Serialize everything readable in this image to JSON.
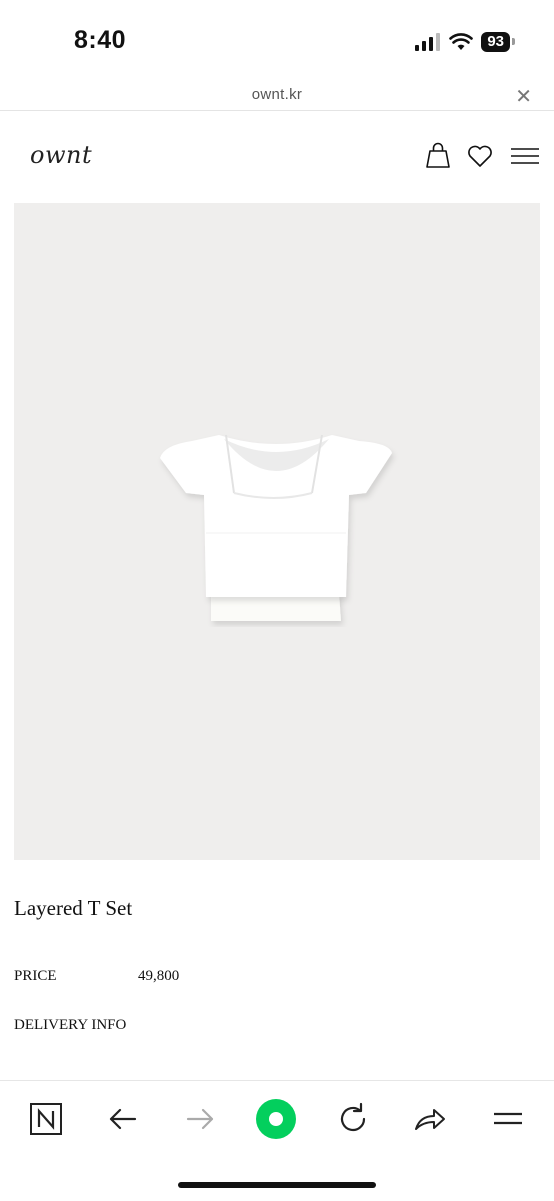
{
  "status_bar": {
    "time": "8:40",
    "battery": "93",
    "icons": [
      "signal-icon",
      "wifi-icon",
      "battery-icon"
    ]
  },
  "browser": {
    "url": "ownt.kr",
    "close_icon": "close-icon"
  },
  "header": {
    "logo": "ownt",
    "icons": [
      "shopping-bag-icon",
      "heart-icon",
      "menu-icon"
    ]
  },
  "product": {
    "image": "white-layered-t-set-photo",
    "name": "Layered T Set",
    "price_label": "PRICE",
    "price_value": "49,800",
    "delivery_label": "DELIVERY INFO"
  },
  "toolbar": {
    "icons": [
      "naver-n-icon",
      "back-arrow-icon",
      "forward-arrow-icon",
      "green-dot-icon",
      "reload-icon",
      "share-icon",
      "menu-icon"
    ],
    "accent": "#03cf5d"
  },
  "colors": {
    "image_bg": "#efeeed",
    "text": "#111111"
  }
}
